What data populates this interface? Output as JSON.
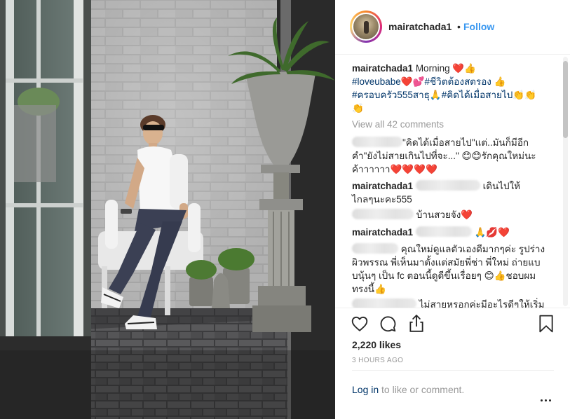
{
  "post": {
    "header": {
      "username": "mairatchada1",
      "separator": "•",
      "follow_label": "Follow"
    },
    "caption": {
      "username": "mairatchada1",
      "line1_text": "Morning ❤️👍",
      "line2_tag1": "#loveubabe",
      "line2_emoji": "❤️💕",
      "line2_tag2": "#ชีวิตต้องสตรอง",
      "line2_end": " 👍",
      "line3_tag1": "#ครอบครัว555สาธุ",
      "line3_emoji": "🙏",
      "line3_tag2": "#คิดได้เมื่อสายไป",
      "line3_end": "👏👏",
      "line4": "👏"
    },
    "view_all_comments": "View all 42 comments",
    "comments": [
      {
        "line1": "\"คิดได้เมื่อสายไป\"แต่..มันก็มีอีก",
        "line2": "คำ\"ยังไม่สายเกินไปที่จะ...\" 😊😊รักคุณใหม่นะ",
        "line3": "ค้าาาาาา❤️❤️❤️❤️"
      },
      {
        "username": "mairatchada1",
        "line1": "เดินไปให้",
        "line2": "ไกลๆนะคะ555"
      },
      {
        "line1": "บ้านสวยจัง❤️"
      },
      {
        "username": "mairatchada1",
        "line1": "🙏💋❤️"
      },
      {
        "line1": "คุณใหม่ดูแลตัวเองดีมากๆค่ะ รูปร่าง",
        "line2": "ผิวพรรณ พี่เห็นมาตั้งแต่สมัยพี่ช่า พี่ใหม่ ถ่ายแบ",
        "line3": "บนุ้นๆ เป็น fc ตอนนี้ดูดีขึ้นเรื่อยๆ 😊👍ชอบผม",
        "line4": "ทรงนี้👍"
      },
      {
        "line1": "ไม่สายหรอกค่ะมีอะไรดีๆให้เริ่ม"
      }
    ],
    "likes": "2,220 likes",
    "timestamp": "3 HOURS AGO",
    "login_link": "Log in",
    "login_suffix": " to like or comment.",
    "icons": [
      "heart-icon",
      "comment-icon",
      "share-icon",
      "bookmark-icon",
      "more-options-icon"
    ],
    "colors": {
      "link_blue": "#3897f0",
      "hashtag": "#003569",
      "muted": "#999999",
      "text": "#262626"
    }
  }
}
